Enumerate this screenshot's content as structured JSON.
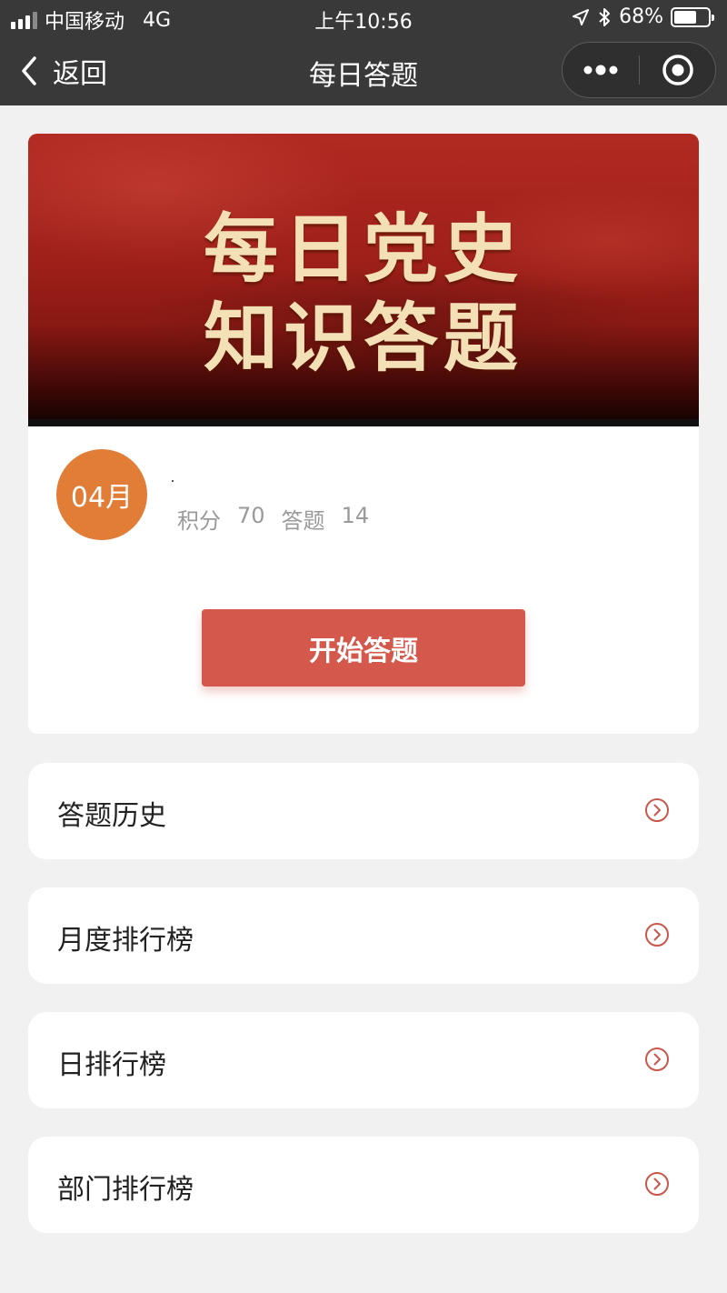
{
  "status_bar": {
    "carrier": "中国移动",
    "network": "4G",
    "time": "上午10:56",
    "battery": "68%",
    "battery_level": 0.68
  },
  "navbar": {
    "back_label": "返回",
    "title": "每日答题",
    "icons": [
      "chevron-left-icon",
      "more-icon",
      "target-icon"
    ]
  },
  "banner": {
    "line1": "每日党史",
    "line2": "知识答题"
  },
  "user": {
    "month": "04月",
    "dot": "·",
    "score_label": "积分",
    "score_value": "70",
    "answered_label": "答题",
    "answered_value": "14"
  },
  "actions": {
    "start_label": "开始答题"
  },
  "menu": [
    {
      "label": "答题历史"
    },
    {
      "label": "月度排行榜"
    },
    {
      "label": "日排行榜"
    },
    {
      "label": "部门排行榜"
    }
  ],
  "colors": {
    "accent": "#d4584c",
    "month_badge": "#e27d38",
    "nav_bg": "#393939",
    "page_bg": "#f1f1f1"
  }
}
